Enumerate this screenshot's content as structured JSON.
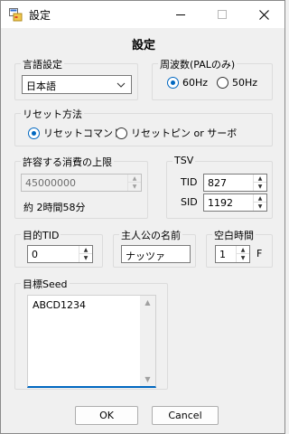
{
  "window": {
    "title": "設定"
  },
  "heading": "設定",
  "language": {
    "legend": "言語設定",
    "selected": "日本語"
  },
  "frequency": {
    "legend": "周波数(PALのみ)",
    "options": [
      "60Hz",
      "50Hz"
    ],
    "selected": "60Hz"
  },
  "reset": {
    "legend": "リセット方法",
    "options": [
      "リセットコマンド",
      "リセットピン or サーボ"
    ],
    "selected": "リセットコマンド"
  },
  "consumption": {
    "legend": "許容する消費の上限",
    "value": "45000000",
    "summary": "約 2時間58分"
  },
  "tsv": {
    "legend": "TSV",
    "tid_label": "TID",
    "tid_value": "827",
    "sid_label": "SID",
    "sid_value": "1192"
  },
  "target_tid": {
    "legend": "目的TID",
    "value": "0"
  },
  "hero_name": {
    "legend": "主人公の名前",
    "value": "ナッツァ"
  },
  "blank_time": {
    "legend": "空白時間",
    "value": "1",
    "unit": "F"
  },
  "target_seed": {
    "legend": "目標Seed",
    "value": "ABCD1234"
  },
  "buttons": {
    "ok": "OK",
    "cancel": "Cancel"
  },
  "colors": {
    "accent": "#0067c0",
    "background": "#f0f0f0"
  }
}
